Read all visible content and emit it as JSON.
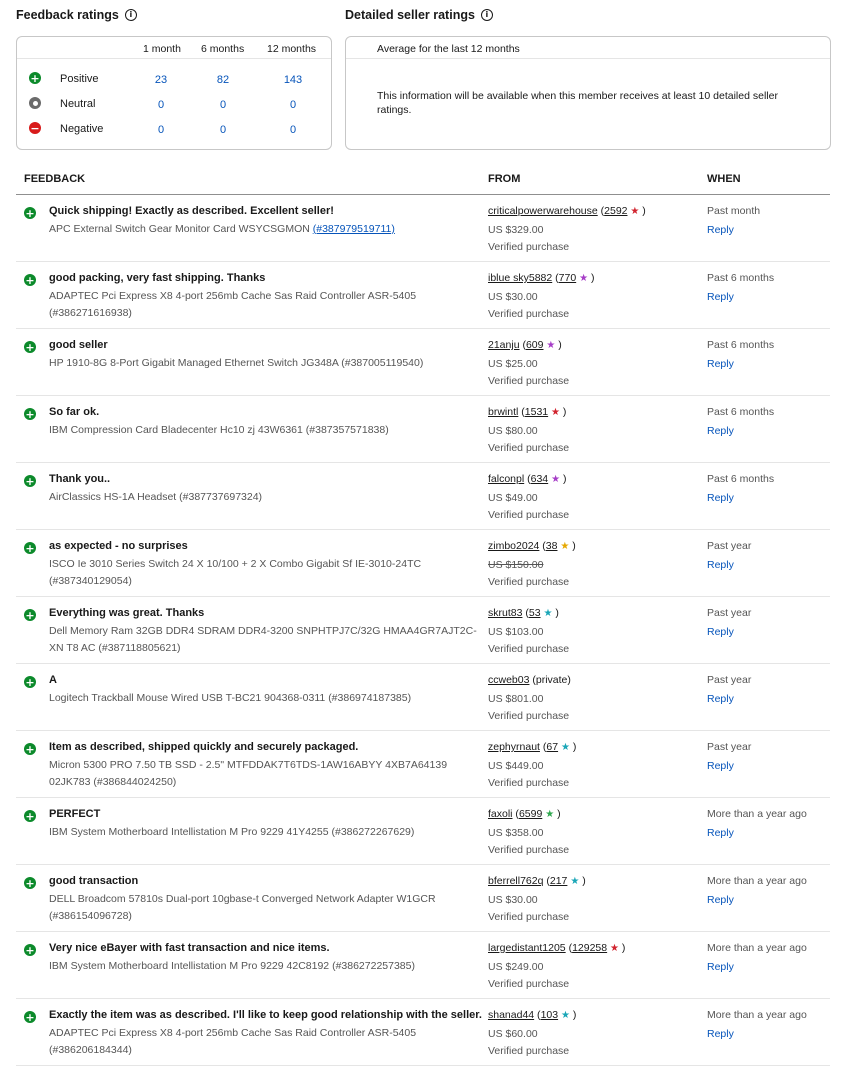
{
  "feedback_ratings": {
    "title": "Feedback ratings",
    "columns": [
      "1 month",
      "6 months",
      "12 months"
    ],
    "rows": [
      {
        "label": "Positive",
        "values": [
          "23",
          "82",
          "143"
        ],
        "type": "pos"
      },
      {
        "label": "Neutral",
        "values": [
          "0",
          "0",
          "0"
        ],
        "type": "neu"
      },
      {
        "label": "Negative",
        "values": [
          "0",
          "0",
          "0"
        ],
        "type": "neg"
      }
    ]
  },
  "detailed_ratings": {
    "title": "Detailed seller ratings",
    "subtitle": "Average for the last 12 months",
    "message": "This information will be available when this member receives at least 10 detailed seller ratings."
  },
  "table": {
    "headers": {
      "feedback": "FEEDBACK",
      "from": "FROM",
      "when": "WHEN"
    },
    "reply_label": "Reply",
    "verified_label": "Verified purchase"
  },
  "colors": {
    "positive": "#0c8a2b",
    "link": "#0654ba",
    "star_red": "#d1242f",
    "star_purple": "#a63dc7",
    "star_yellow": "#e6a800",
    "star_turquoise": "#1aa6b7",
    "star_green": "#2fa84f"
  },
  "rows": [
    {
      "comment": "Quick shipping! Exactly as described. Excellent seller!",
      "item": "APC External Switch Gear Monitor Card WSYCSGMON",
      "item_num": "(#387979519711)",
      "item_num_link": true,
      "user": "criticalpowerwarehouse",
      "score": "2592",
      "star": "#d1242f",
      "price": "US $329.00",
      "strike": false,
      "when": "Past month"
    },
    {
      "comment": "good packing, very fast shipping. Thanks",
      "item": "ADAPTEC Pci Express X8 4-port 256mb Cache Sas Raid Controller ASR-5405",
      "item_num": "(#386271616938)",
      "item_num_link": false,
      "user": "iblue sky5882",
      "score": "770",
      "star": "#a63dc7",
      "price": "US $30.00",
      "strike": false,
      "when": "Past 6 months"
    },
    {
      "comment": "good seller",
      "item": "HP 1910-8G 8-Port Gigabit Managed Ethernet Switch JG348A",
      "item_num": "(#387005119540)",
      "item_num_link": false,
      "user": "21anju",
      "score": "609",
      "star": "#a63dc7",
      "price": "US $25.00",
      "strike": false,
      "when": "Past 6 months"
    },
    {
      "comment": "So far ok.",
      "item": "IBM Compression Card Bladecenter Hc10 zj 43W6361",
      "item_num": "(#387357571838)",
      "item_num_link": false,
      "user": "brwintl",
      "score": "1531",
      "star": "#d1242f",
      "price": "US $80.00",
      "strike": false,
      "when": "Past 6 months"
    },
    {
      "comment": "Thank you..",
      "item": "AirClassics HS-1A Headset",
      "item_num": "(#387737697324)",
      "item_num_link": false,
      "user": "falconpl",
      "score": "634",
      "star": "#a63dc7",
      "price": "US $49.00",
      "strike": false,
      "when": "Past 6 months"
    },
    {
      "comment": "as expected - no surprises",
      "item": "ISCO Ie 3010 Series Switch 24 X 10/100 + 2 X Combo Gigabit Sf IE-3010-24TC",
      "item_num": "(#387340129054)",
      "item_num_link": false,
      "user": "zimbo2024",
      "score": "38",
      "star": "#e6a800",
      "price": "US $150.00",
      "strike": true,
      "when": "Past year"
    },
    {
      "comment": "Everything was great. Thanks",
      "item": "Dell Memory Ram 32GB DDR4 SDRAM DDR4-3200 SNPHTPJ7C/32G HMAA4GR7AJT2C-XN T8 AC",
      "item_num": "(#387118805621)",
      "item_num_link": false,
      "user": "skrut83",
      "score": "53",
      "star": "#1aa6b7",
      "price": "US $103.00",
      "strike": false,
      "when": "Past year"
    },
    {
      "comment": "A",
      "item": "Logitech Trackball Mouse Wired USB T-BC21 904368-0311",
      "item_num": "(#386974187385)",
      "item_num_link": false,
      "user": "ccweb03",
      "score": "",
      "private": "(private)",
      "star": "",
      "price": "US $801.00",
      "strike": false,
      "when": "Past year"
    },
    {
      "comment": "Item as described, shipped quickly and securely packaged.",
      "item": "Micron 5300 PRO 7.50 TB SSD - 2.5\" MTFDDAK7T6TDS-1AW16ABYY 4XB7A64139 02JK783",
      "item_num": "(#386844024250)",
      "item_num_link": false,
      "user": "zephyrnaut",
      "score": "67",
      "star": "#1aa6b7",
      "price": "US $449.00",
      "strike": false,
      "when": "Past year"
    },
    {
      "comment": "PERFECT",
      "item": "IBM System Motherboard Intellistation M Pro 9229 41Y4255",
      "item_num": "(#386272267629)",
      "item_num_link": false,
      "user": "faxoli",
      "score": "6599",
      "star": "#2fa84f",
      "price": "US $358.00",
      "strike": false,
      "when": "More than a year ago"
    },
    {
      "comment": "good transaction",
      "item": "DELL Broadcom 57810s Dual-port 10gbase-t Converged Network Adapter W1GCR",
      "item_num": "(#386154096728)",
      "item_num_link": false,
      "user": "bferrell762q",
      "score": "217",
      "star": "#1aa6b7",
      "price": "US $30.00",
      "strike": false,
      "when": "More than a year ago"
    },
    {
      "comment": "Very nice eBayer with fast transaction and nice items.",
      "item": "IBM System Motherboard Intellistation M Pro 9229 42C8192",
      "item_num": "(#386272257385)",
      "item_num_link": false,
      "user": "largedistant1205",
      "score": "129258",
      "star": "#d1242f",
      "price": "US $249.00",
      "strike": false,
      "when": "More than a year ago"
    },
    {
      "comment": "Exactly the item was as described. I'll like to keep good relationship with the seller.",
      "item": "ADAPTEC Pci Express X8 4-port 256mb Cache Sas Raid Controller ASR-5405",
      "item_num": "(#386206184344)",
      "item_num_link": false,
      "user": "shanad44",
      "score": "103",
      "star": "#1aa6b7",
      "price": "US $60.00",
      "strike": false,
      "when": "More than a year ago"
    }
  ]
}
